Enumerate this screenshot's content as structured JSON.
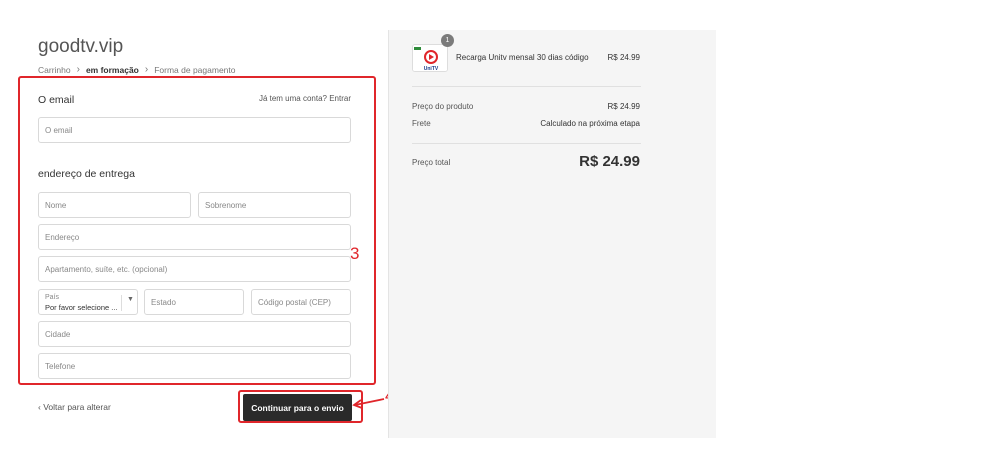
{
  "header": {
    "store_title": "goodtv.vip",
    "breadcrumb": [
      "Carrinho",
      "em formação",
      "Forma de pagamento"
    ]
  },
  "contact": {
    "section_title": "O email",
    "login_prompt": "Já tem uma conta? Entrar",
    "email_placeholder": "O email"
  },
  "shipping": {
    "section_title": "endereço de entrega",
    "first_name_placeholder": "Nome",
    "last_name_placeholder": "Sobrenome",
    "address_placeholder": "Endereço",
    "apartment_placeholder": "Apartamento, suíte, etc. (opcional)",
    "country_label": "País",
    "country_value": "Por favor selecione ...",
    "state_placeholder": "Estado",
    "postal_placeholder": "Código postal (CEP)",
    "city_placeholder": "Cidade",
    "phone_placeholder": "Telefone"
  },
  "actions": {
    "back_label": "Voltar para alterar",
    "continue_label": "Continuar para o envio"
  },
  "annotations": {
    "form_marker": "3",
    "button_marker": "4"
  },
  "summary": {
    "product_name": "Recarga Unitv mensal 30 dias código",
    "product_price": "R$ 24.99",
    "quantity": "1",
    "product_logo_text": "UniTV",
    "subtotal_label": "Preço do produto",
    "subtotal_value": "R$ 24.99",
    "shipping_label": "Frete",
    "shipping_value": "Calculado na próxima etapa",
    "total_label": "Preço total",
    "total_value": "R$ 24.99"
  },
  "colors": {
    "annotation": "#e0262b",
    "button_bg": "#2a2a2a",
    "panel_bg": "#f5f5f5"
  }
}
